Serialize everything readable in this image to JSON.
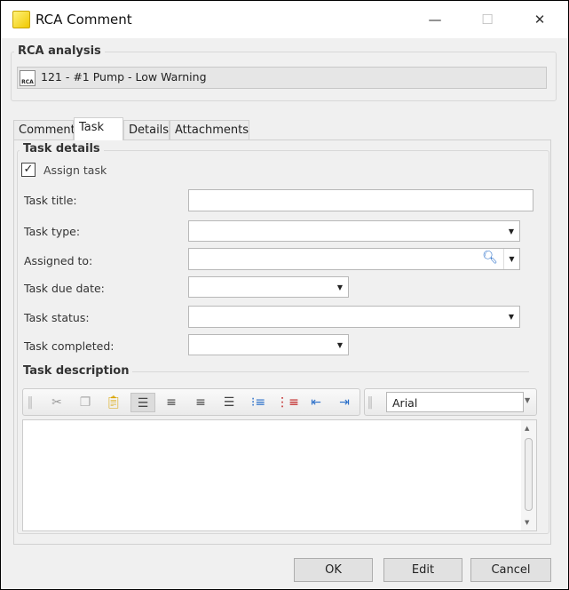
{
  "window": {
    "title": "RCA Comment",
    "minimize": "—",
    "maximize": "☐",
    "close": "✕"
  },
  "rca_group": {
    "label": "RCA analysis",
    "value": "121 - #1 Pump - Low Warning"
  },
  "tabs": [
    {
      "label": "Comment"
    },
    {
      "label": "Task",
      "active": true
    },
    {
      "label": "Details"
    },
    {
      "label": "Attachments"
    }
  ],
  "task_details": {
    "label": "Task details",
    "assign_task": {
      "label": "Assign task",
      "checked": true
    },
    "fields": {
      "title": "Task title:",
      "type": "Task type:",
      "assigned": "Assigned to:",
      "due": "Task due date:",
      "status": "Task status:",
      "completed": "Task completed:"
    }
  },
  "description": {
    "label": "Task description",
    "font": "Arial"
  },
  "buttons": {
    "ok": "OK",
    "edit": "Edit",
    "cancel": "Cancel"
  }
}
